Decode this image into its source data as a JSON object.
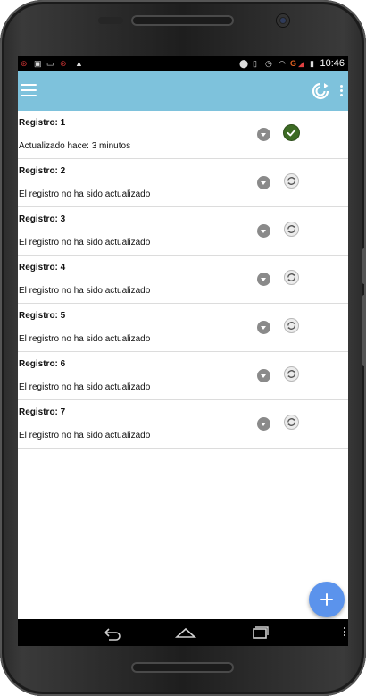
{
  "statusbar": {
    "time": "10:46",
    "icons": [
      "notification-icon",
      "image-icon",
      "notification-icon",
      "warning-icon",
      "location-icon",
      "vibrate-icon",
      "alarm-icon",
      "wifi-icon",
      "signal-icon",
      "battery-icon"
    ],
    "network_label": "G"
  },
  "appbar": {
    "menu_icon": "hamburger-menu-icon",
    "sync_icon": "sync-all-icon",
    "overflow_icon": "overflow-menu-icon"
  },
  "records": [
    {
      "title": "Registro: 1",
      "status": "Actualizado hace: 3 minutos",
      "state": "updated"
    },
    {
      "title": "Registro: 2",
      "status": "El registro no ha sido actualizado",
      "state": "pending"
    },
    {
      "title": "Registro: 3",
      "status": "El registro no ha sido actualizado",
      "state": "pending"
    },
    {
      "title": "Registro: 4",
      "status": "El registro no ha sido actualizado",
      "state": "pending"
    },
    {
      "title": "Registro: 5",
      "status": "El registro no ha sido actualizado",
      "state": "pending"
    },
    {
      "title": "Registro: 6",
      "status": "El registro no ha sido actualizado",
      "state": "pending"
    },
    {
      "title": "Registro: 7",
      "status": "El registro no ha sido actualizado",
      "state": "pending"
    }
  ],
  "fab": {
    "icon": "plus-icon"
  },
  "colors": {
    "appbar": "#7ec2dc",
    "fab": "#5b93ec",
    "updated": "#3d6b24",
    "dropdown": "#8a8a8a"
  }
}
